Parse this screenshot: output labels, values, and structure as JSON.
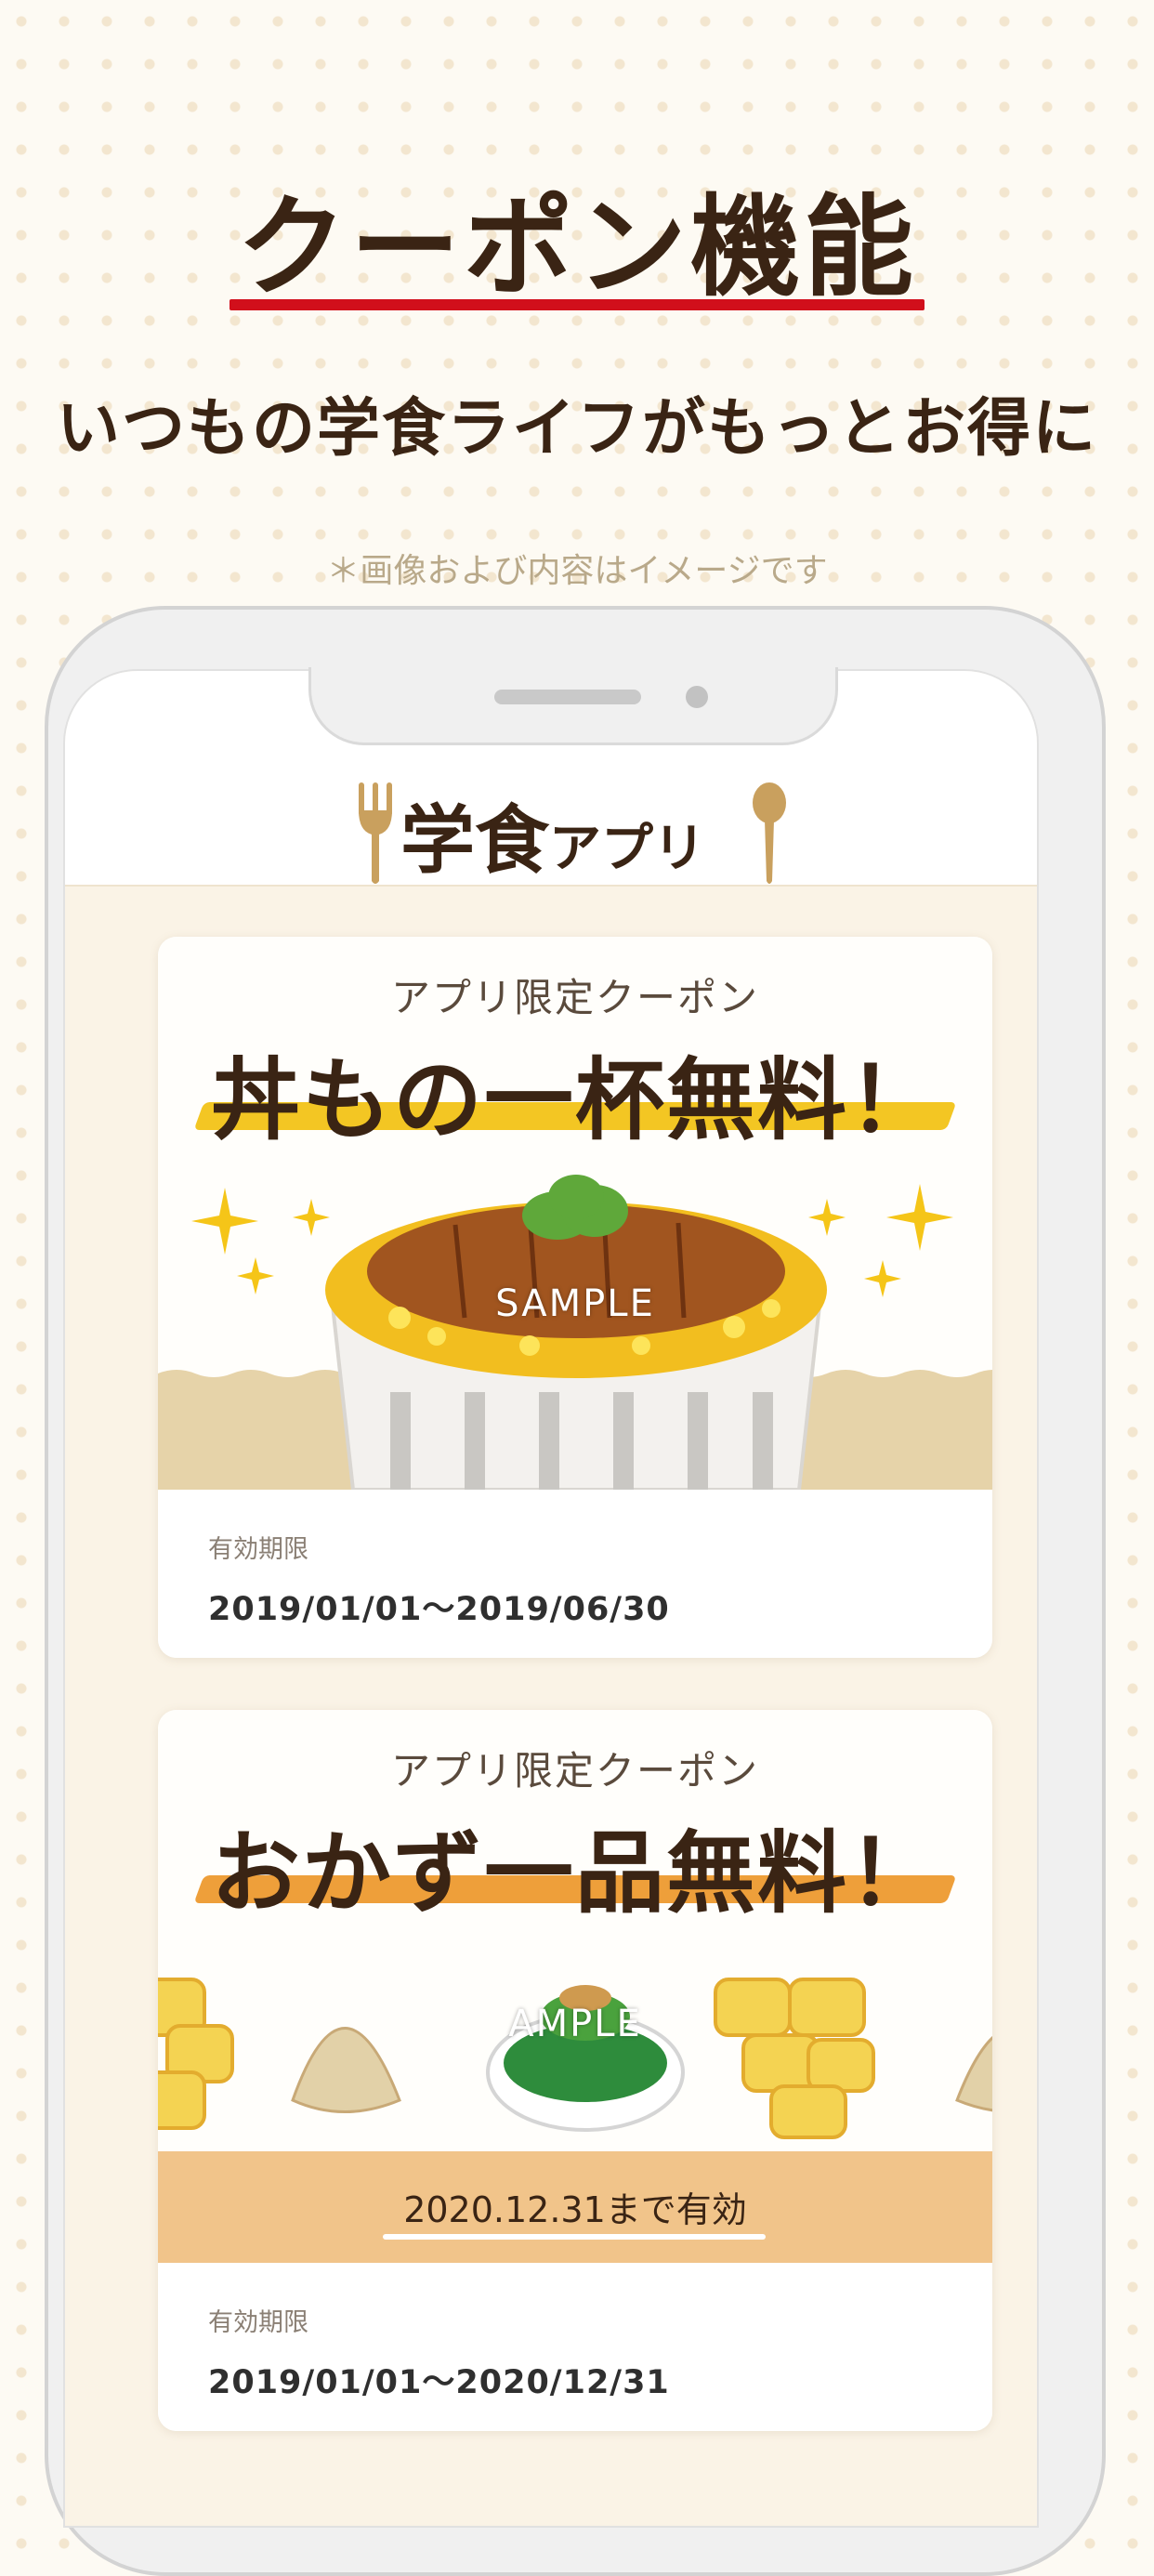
{
  "hero": {
    "title": "クーポン機能",
    "subtitle": "いつもの学食ライフがもっとお得に",
    "disclaimer": "＊画像および内容はイメージです"
  },
  "app": {
    "logo_main": "学食",
    "logo_small": "アプリ"
  },
  "coupons": [
    {
      "label": "アプリ限定クーポン",
      "headline": "丼もの一杯無料！",
      "watermark": "SAMPLE",
      "valid_label": "有効期限",
      "valid_dates": "2019/01/01〜2019/06/30",
      "accent": "#f3c623"
    },
    {
      "label": "アプリ限定クーポン",
      "headline": "おかず一品無料！",
      "watermark": "AMPLE",
      "expire_note": "2020.12.31まで有効",
      "valid_label": "有効期限",
      "valid_dates": "2019/01/01〜2020/12/31",
      "accent": "#ee9f3a"
    }
  ],
  "colors": {
    "brand_red": "#d10f1b",
    "text_brown": "#3a2414",
    "background": "#fdfaf3"
  }
}
